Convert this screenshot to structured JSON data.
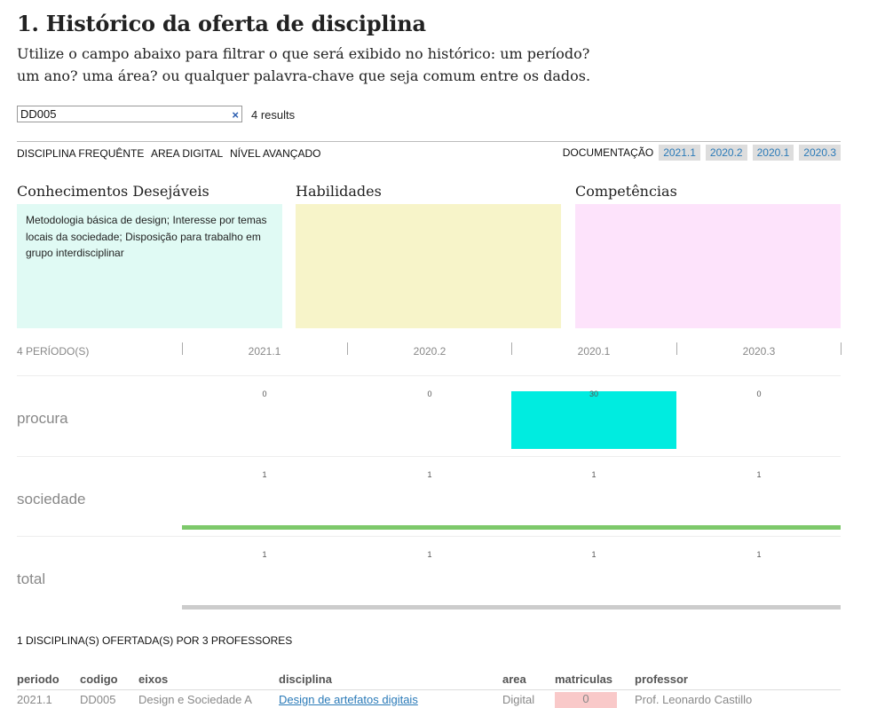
{
  "header": {
    "title": "1. Histórico da oferta de disciplina",
    "intro": "Utilize o campo abaixo para filtrar o que será exibido no histórico: um período? um ano? uma área? ou qualquer palavra-chave que seja comum entre os dados."
  },
  "search": {
    "value": "DD005",
    "clear_icon": "×",
    "results": "4 results"
  },
  "tags": {
    "frequency": "DISCIPLINA FREQUÊNTE",
    "area": "AREA DIGITAL",
    "level": "NÍVEL AVANÇADO"
  },
  "documentation": {
    "label": "DOCUMENTAÇÃO",
    "links": [
      "2021.1",
      "2020.2",
      "2020.1",
      "2020.3"
    ]
  },
  "boxes": [
    {
      "title": "Conhecimentos Desejáveis",
      "text": "Metodologia básica de design; Interesse por temas locais da sociedade; Disposição para trabalho em grupo interdisciplinar",
      "color": "#e0faf4"
    },
    {
      "title": "Habilidades",
      "text": "",
      "color": "#f7f4c9"
    },
    {
      "title": "Competências",
      "text": "",
      "color": "#fde3fb"
    }
  ],
  "timeline": {
    "axis_label": "4 PERÍODO(S)",
    "periods": [
      "2021.1",
      "2020.2",
      "2020.1",
      "2020.3"
    ],
    "rows": [
      {
        "label": "procura",
        "values": [
          0,
          0,
          30,
          0
        ],
        "color": "#00ece0"
      },
      {
        "label": "sociedade",
        "values": [
          1,
          1,
          1,
          1
        ],
        "color": "#7dc96b"
      },
      {
        "label": "total",
        "values": [
          1,
          1,
          1,
          1
        ],
        "color": "#cccccc"
      }
    ]
  },
  "summary": {
    "offered": "1 DISCIPLINA(S) OFERTADA(S) POR 3 PROFESSORES"
  },
  "table": {
    "headers": [
      "periodo",
      "codigo",
      "eixos",
      "disciplina",
      "area",
      "matriculas",
      "professor"
    ],
    "rows": [
      {
        "periodo": "2021.1",
        "codigo": "DD005",
        "eixos": "Design e Sociedade A",
        "disciplina": "Design de artefatos digitais",
        "area": "Digital",
        "matriculas": "0",
        "professor": "Prof. Leonardo Castillo"
      }
    ]
  }
}
